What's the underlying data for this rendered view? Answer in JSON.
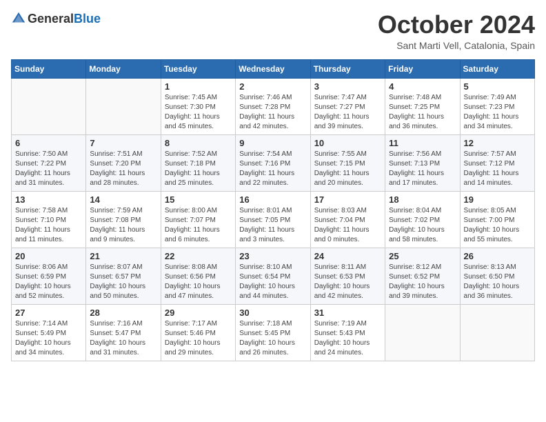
{
  "header": {
    "logo_general": "General",
    "logo_blue": "Blue",
    "month_title": "October 2024",
    "location": "Sant Marti Vell, Catalonia, Spain"
  },
  "weekdays": [
    "Sunday",
    "Monday",
    "Tuesday",
    "Wednesday",
    "Thursday",
    "Friday",
    "Saturday"
  ],
  "weeks": [
    [
      {
        "day": "",
        "sunrise": "",
        "sunset": "",
        "daylight": ""
      },
      {
        "day": "",
        "sunrise": "",
        "sunset": "",
        "daylight": ""
      },
      {
        "day": "1",
        "sunrise": "Sunrise: 7:45 AM",
        "sunset": "Sunset: 7:30 PM",
        "daylight": "Daylight: 11 hours and 45 minutes."
      },
      {
        "day": "2",
        "sunrise": "Sunrise: 7:46 AM",
        "sunset": "Sunset: 7:28 PM",
        "daylight": "Daylight: 11 hours and 42 minutes."
      },
      {
        "day": "3",
        "sunrise": "Sunrise: 7:47 AM",
        "sunset": "Sunset: 7:27 PM",
        "daylight": "Daylight: 11 hours and 39 minutes."
      },
      {
        "day": "4",
        "sunrise": "Sunrise: 7:48 AM",
        "sunset": "Sunset: 7:25 PM",
        "daylight": "Daylight: 11 hours and 36 minutes."
      },
      {
        "day": "5",
        "sunrise": "Sunrise: 7:49 AM",
        "sunset": "Sunset: 7:23 PM",
        "daylight": "Daylight: 11 hours and 34 minutes."
      }
    ],
    [
      {
        "day": "6",
        "sunrise": "Sunrise: 7:50 AM",
        "sunset": "Sunset: 7:22 PM",
        "daylight": "Daylight: 11 hours and 31 minutes."
      },
      {
        "day": "7",
        "sunrise": "Sunrise: 7:51 AM",
        "sunset": "Sunset: 7:20 PM",
        "daylight": "Daylight: 11 hours and 28 minutes."
      },
      {
        "day": "8",
        "sunrise": "Sunrise: 7:52 AM",
        "sunset": "Sunset: 7:18 PM",
        "daylight": "Daylight: 11 hours and 25 minutes."
      },
      {
        "day": "9",
        "sunrise": "Sunrise: 7:54 AM",
        "sunset": "Sunset: 7:16 PM",
        "daylight": "Daylight: 11 hours and 22 minutes."
      },
      {
        "day": "10",
        "sunrise": "Sunrise: 7:55 AM",
        "sunset": "Sunset: 7:15 PM",
        "daylight": "Daylight: 11 hours and 20 minutes."
      },
      {
        "day": "11",
        "sunrise": "Sunrise: 7:56 AM",
        "sunset": "Sunset: 7:13 PM",
        "daylight": "Daylight: 11 hours and 17 minutes."
      },
      {
        "day": "12",
        "sunrise": "Sunrise: 7:57 AM",
        "sunset": "Sunset: 7:12 PM",
        "daylight": "Daylight: 11 hours and 14 minutes."
      }
    ],
    [
      {
        "day": "13",
        "sunrise": "Sunrise: 7:58 AM",
        "sunset": "Sunset: 7:10 PM",
        "daylight": "Daylight: 11 hours and 11 minutes."
      },
      {
        "day": "14",
        "sunrise": "Sunrise: 7:59 AM",
        "sunset": "Sunset: 7:08 PM",
        "daylight": "Daylight: 11 hours and 9 minutes."
      },
      {
        "day": "15",
        "sunrise": "Sunrise: 8:00 AM",
        "sunset": "Sunset: 7:07 PM",
        "daylight": "Daylight: 11 hours and 6 minutes."
      },
      {
        "day": "16",
        "sunrise": "Sunrise: 8:01 AM",
        "sunset": "Sunset: 7:05 PM",
        "daylight": "Daylight: 11 hours and 3 minutes."
      },
      {
        "day": "17",
        "sunrise": "Sunrise: 8:03 AM",
        "sunset": "Sunset: 7:04 PM",
        "daylight": "Daylight: 11 hours and 0 minutes."
      },
      {
        "day": "18",
        "sunrise": "Sunrise: 8:04 AM",
        "sunset": "Sunset: 7:02 PM",
        "daylight": "Daylight: 10 hours and 58 minutes."
      },
      {
        "day": "19",
        "sunrise": "Sunrise: 8:05 AM",
        "sunset": "Sunset: 7:00 PM",
        "daylight": "Daylight: 10 hours and 55 minutes."
      }
    ],
    [
      {
        "day": "20",
        "sunrise": "Sunrise: 8:06 AM",
        "sunset": "Sunset: 6:59 PM",
        "daylight": "Daylight: 10 hours and 52 minutes."
      },
      {
        "day": "21",
        "sunrise": "Sunrise: 8:07 AM",
        "sunset": "Sunset: 6:57 PM",
        "daylight": "Daylight: 10 hours and 50 minutes."
      },
      {
        "day": "22",
        "sunrise": "Sunrise: 8:08 AM",
        "sunset": "Sunset: 6:56 PM",
        "daylight": "Daylight: 10 hours and 47 minutes."
      },
      {
        "day": "23",
        "sunrise": "Sunrise: 8:10 AM",
        "sunset": "Sunset: 6:54 PM",
        "daylight": "Daylight: 10 hours and 44 minutes."
      },
      {
        "day": "24",
        "sunrise": "Sunrise: 8:11 AM",
        "sunset": "Sunset: 6:53 PM",
        "daylight": "Daylight: 10 hours and 42 minutes."
      },
      {
        "day": "25",
        "sunrise": "Sunrise: 8:12 AM",
        "sunset": "Sunset: 6:52 PM",
        "daylight": "Daylight: 10 hours and 39 minutes."
      },
      {
        "day": "26",
        "sunrise": "Sunrise: 8:13 AM",
        "sunset": "Sunset: 6:50 PM",
        "daylight": "Daylight: 10 hours and 36 minutes."
      }
    ],
    [
      {
        "day": "27",
        "sunrise": "Sunrise: 7:14 AM",
        "sunset": "Sunset: 5:49 PM",
        "daylight": "Daylight: 10 hours and 34 minutes."
      },
      {
        "day": "28",
        "sunrise": "Sunrise: 7:16 AM",
        "sunset": "Sunset: 5:47 PM",
        "daylight": "Daylight: 10 hours and 31 minutes."
      },
      {
        "day": "29",
        "sunrise": "Sunrise: 7:17 AM",
        "sunset": "Sunset: 5:46 PM",
        "daylight": "Daylight: 10 hours and 29 minutes."
      },
      {
        "day": "30",
        "sunrise": "Sunrise: 7:18 AM",
        "sunset": "Sunset: 5:45 PM",
        "daylight": "Daylight: 10 hours and 26 minutes."
      },
      {
        "day": "31",
        "sunrise": "Sunrise: 7:19 AM",
        "sunset": "Sunset: 5:43 PM",
        "daylight": "Daylight: 10 hours and 24 minutes."
      },
      {
        "day": "",
        "sunrise": "",
        "sunset": "",
        "daylight": ""
      },
      {
        "day": "",
        "sunrise": "",
        "sunset": "",
        "daylight": ""
      }
    ]
  ]
}
